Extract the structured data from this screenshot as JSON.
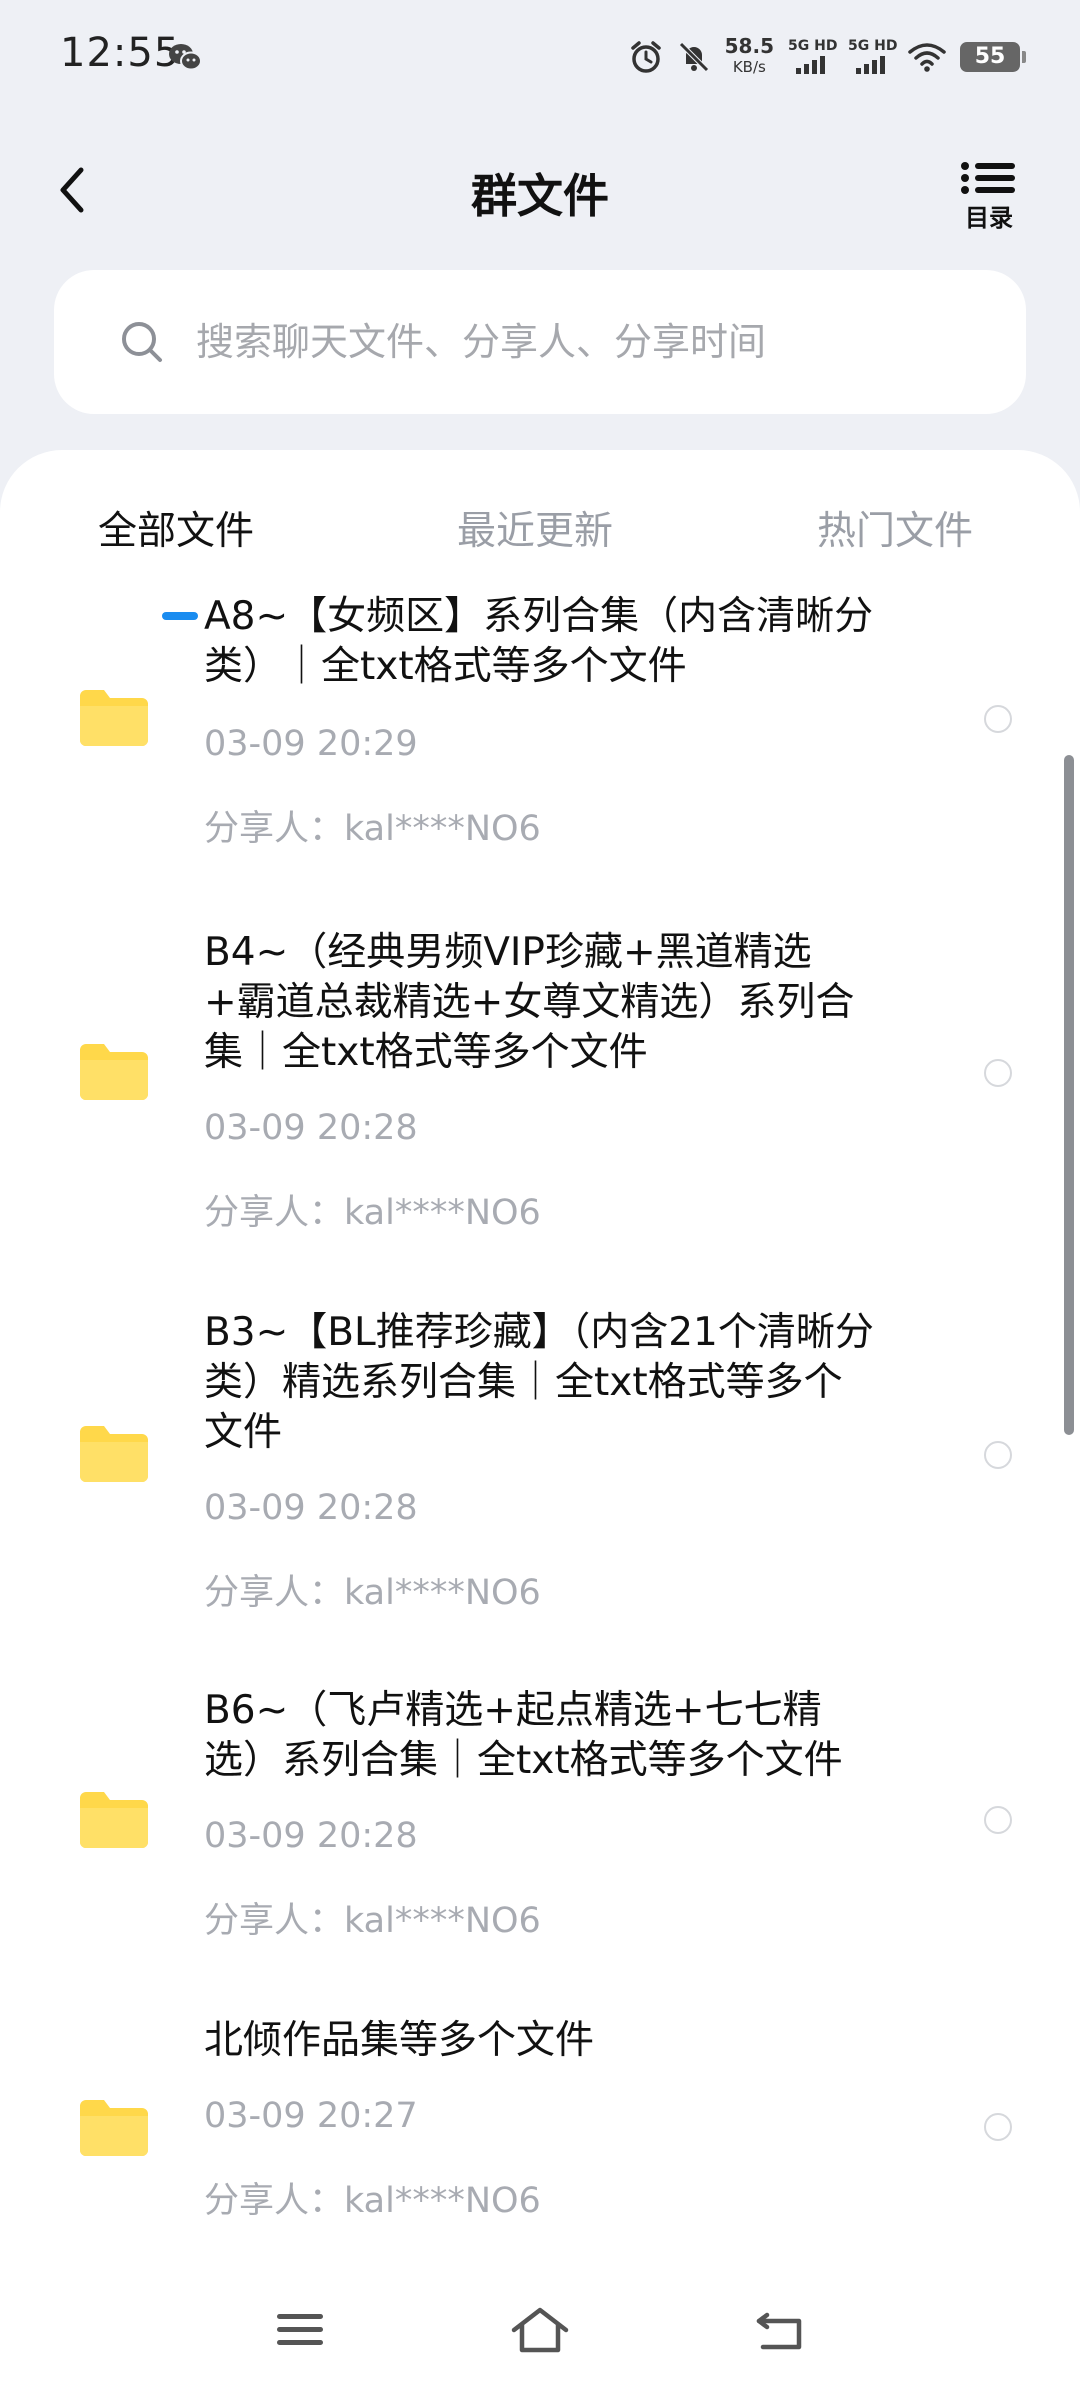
{
  "status_bar": {
    "time": "12:55",
    "net_speed_value": "58.5",
    "net_speed_unit": "KB/s",
    "signal1_label": "5G HD",
    "signal2_label": "5G HD",
    "battery": "55"
  },
  "header": {
    "title": "群文件",
    "directory_label": "目录"
  },
  "search": {
    "placeholder": "搜索聊天文件、分享人、分享时间"
  },
  "tabs": [
    {
      "label": "全部文件",
      "active": true
    },
    {
      "label": "最近更新",
      "active": false
    },
    {
      "label": "热门文件",
      "active": false
    }
  ],
  "files": [
    {
      "title_lines": [
        "A8~【女频区】系列合集（内含清晰分",
        "类）｜全txt格式等多个文件"
      ],
      "time": "03-09  20:29",
      "sharer": "分享人：kal****NO6"
    },
    {
      "title_lines": [
        "B4~（经典男频VIP珍藏+黑道精选",
        "+霸道总裁精选+女尊文精选）系列合",
        "集｜全txt格式等多个文件"
      ],
      "time": "03-09  20:28",
      "sharer": "分享人：kal****NO6"
    },
    {
      "title_lines": [
        "B3~【BL推荐珍藏】（内含21个清晰分",
        "类）精选系列合集｜全txt格式等多个",
        "文件"
      ],
      "time": "03-09  20:28",
      "sharer": "分享人：kal****NO6"
    },
    {
      "title_lines": [
        "B6~（飞卢精选+起点精选+七七精",
        "选）系列合集｜全txt格式等多个文件"
      ],
      "time": "03-09  20:28",
      "sharer": "分享人：kal****NO6"
    },
    {
      "title_lines": [
        "北倾作品集等多个文件"
      ],
      "time": "03-09  20:27",
      "sharer": "分享人：kal****NO6"
    }
  ],
  "colors": {
    "accent": "#1a8cf0",
    "folder": "#ffd84a",
    "background": "#eef0f5"
  },
  "icons": [
    "back-icon",
    "directory-icon",
    "search-icon",
    "folder-icon",
    "menu-icon",
    "home-icon",
    "return-icon",
    "wechat-icon",
    "alarm-icon",
    "mute-icon",
    "wifi-icon"
  ]
}
